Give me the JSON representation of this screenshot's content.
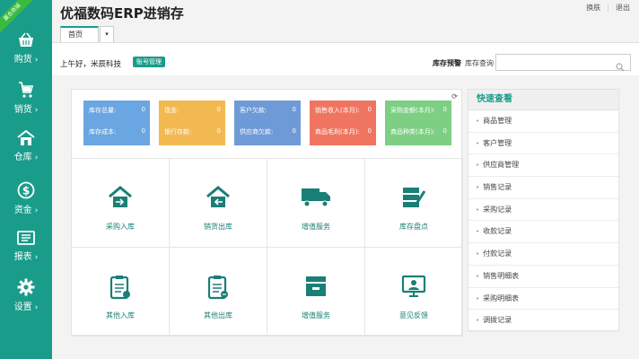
{
  "app": {
    "title": "优福数码ERP进销存",
    "ribbon": "赢合商城"
  },
  "top_links": {
    "switch": "换肤",
    "logout": "退出"
  },
  "tabs": {
    "home": "首页",
    "arrow": "▾"
  },
  "greeting": {
    "text": "上午好，米辰科技",
    "account_button": "账号管理"
  },
  "search": {
    "stock_alert": "库存预警",
    "stock_query": "库存查询",
    "placeholder": ""
  },
  "sidebar": {
    "items": [
      {
        "label": "购货",
        "icon": "basket-icon"
      },
      {
        "label": "销货",
        "icon": "cart-icon"
      },
      {
        "label": "仓库",
        "icon": "warehouse-icon"
      },
      {
        "label": "资金",
        "icon": "dollar-icon"
      },
      {
        "label": "报表",
        "icon": "report-icon"
      },
      {
        "label": "设置",
        "icon": "gear-icon"
      }
    ]
  },
  "cards": [
    {
      "color": "#6aa6e2",
      "row1_label": "库存总量:",
      "row1_value": "0",
      "row2_label": "库存成本:",
      "row2_value": "0"
    },
    {
      "color": "#f2b951",
      "row1_label": "现金:",
      "row1_value": "0",
      "row2_label": "银行存款:",
      "row2_value": "0"
    },
    {
      "color": "#6e9ad8",
      "row1_label": "客户欠款:",
      "row1_value": "0",
      "row2_label": "供应商欠款:",
      "row2_value": "0"
    },
    {
      "color": "#f07560",
      "row1_label": "销售收入(本月):",
      "row1_value": "0",
      "row2_label": "商品毛利(本月):",
      "row2_value": "0"
    },
    {
      "color": "#7ccf83",
      "row1_label": "采购金额(本月):",
      "row1_value": "0",
      "row2_label": "商品种类(本月):",
      "row2_value": "0"
    }
  ],
  "grid": [
    {
      "label": "采购入库",
      "icon": "purchase-in-icon"
    },
    {
      "label": "销货出库",
      "icon": "sales-out-icon"
    },
    {
      "label": "增值服务",
      "icon": "truck-icon"
    },
    {
      "label": "库存盘点",
      "icon": "inventory-icon"
    },
    {
      "label": "其他入库",
      "icon": "other-in-icon"
    },
    {
      "label": "其他出库",
      "icon": "other-out-icon"
    },
    {
      "label": "增值服务",
      "icon": "service-box-icon"
    },
    {
      "label": "意见反馈",
      "icon": "feedback-icon"
    }
  ],
  "quick": {
    "title": "快速查看",
    "items": [
      "商品管理",
      "客户管理",
      "供应商管理",
      "销售记录",
      "采购记录",
      "收款记录",
      "付款记录",
      "销售明细表",
      "采购明细表",
      "调拨记录"
    ]
  },
  "colors": {
    "accent": "#1a9c8b"
  }
}
